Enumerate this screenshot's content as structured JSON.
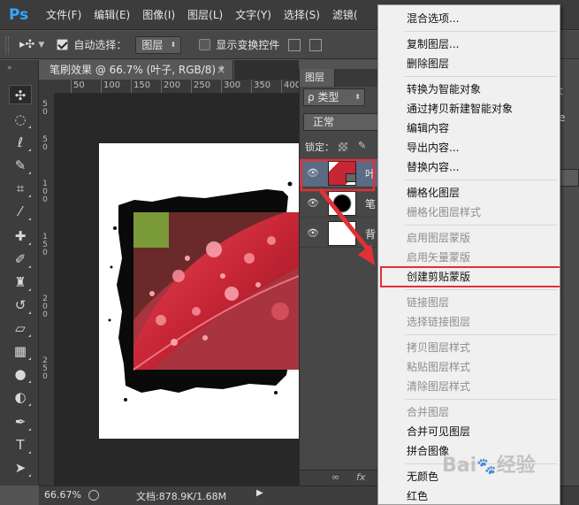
{
  "menubar": {
    "logo": "Ps",
    "items": [
      "文件(F)",
      "编辑(E)",
      "图像(I)",
      "图层(L)",
      "文字(Y)",
      "选择(S)",
      "滤镜("
    ]
  },
  "options": {
    "auto_select_label": "自动选择：",
    "auto_select_checked": true,
    "target_value": "图层",
    "transform_label": "显示变换控件",
    "transform_checked": false
  },
  "document": {
    "tab_title": "笔刷效果 @ 66.7% (叶子, RGB/8) *",
    "close_glyph": "×",
    "ruler_numbers": [
      "50",
      "100",
      "150",
      "200",
      "250",
      "300",
      "350",
      "400"
    ],
    "vruler_numbers": [
      "5",
      "0",
      "5",
      "0",
      "1",
      "0",
      "0",
      "1",
      "5",
      "0",
      "2",
      "0",
      "0",
      "2",
      "5",
      "0"
    ]
  },
  "status": {
    "zoom": "66.67%",
    "doc_info": "文档:878.9K/1.68M",
    "arrow": "▶"
  },
  "layers_panel": {
    "tab_label": "图层",
    "filter_value": "ρ 类型",
    "blend_mode": "正常",
    "lock_label": "锁定：",
    "layers": [
      {
        "name": "叶",
        "selected": true
      },
      {
        "name": "笔",
        "selected": false
      },
      {
        "name": "背",
        "selected": false
      }
    ],
    "footer": {
      "link": "∞",
      "fx": "fx"
    }
  },
  "right_strip": {
    "text1": "t",
    "text2": "e"
  },
  "context_menu": {
    "items": [
      {
        "label": "混合选项...",
        "enabled": true
      },
      {
        "sep": true
      },
      {
        "label": "复制图层...",
        "enabled": true
      },
      {
        "label": "删除图层",
        "enabled": true
      },
      {
        "sep": true
      },
      {
        "label": "转换为智能对象",
        "enabled": true
      },
      {
        "label": "通过拷贝新建智能对象",
        "enabled": true
      },
      {
        "label": "编辑内容",
        "enabled": true
      },
      {
        "label": "导出内容...",
        "enabled": true
      },
      {
        "label": "替换内容...",
        "enabled": true
      },
      {
        "sep": true
      },
      {
        "label": "栅格化图层",
        "enabled": true
      },
      {
        "label": "栅格化图层样式",
        "enabled": false
      },
      {
        "sep": true
      },
      {
        "label": "启用图层蒙版",
        "enabled": false
      },
      {
        "label": "启用矢量蒙版",
        "enabled": false
      },
      {
        "label": "创建剪贴蒙版",
        "enabled": true,
        "highlighted": true
      },
      {
        "sep": true
      },
      {
        "label": "链接图层",
        "enabled": false
      },
      {
        "label": "选择链接图层",
        "enabled": false
      },
      {
        "sep": true
      },
      {
        "label": "拷贝图层样式",
        "enabled": false
      },
      {
        "label": "粘贴图层样式",
        "enabled": false
      },
      {
        "label": "清除图层样式",
        "enabled": false
      },
      {
        "sep": true
      },
      {
        "label": "合并图层",
        "enabled": false
      },
      {
        "label": "合并可见图层",
        "enabled": true
      },
      {
        "label": "拼合图像",
        "enabled": true
      },
      {
        "sep": true
      },
      {
        "label": "无颜色",
        "enabled": true
      },
      {
        "label": "红色",
        "enabled": true
      }
    ]
  },
  "colors": {
    "highlight_border": "#e03137",
    "arrow": "#e03137",
    "leaf_red": "#c72635"
  },
  "watermark": "Baidu 经验"
}
